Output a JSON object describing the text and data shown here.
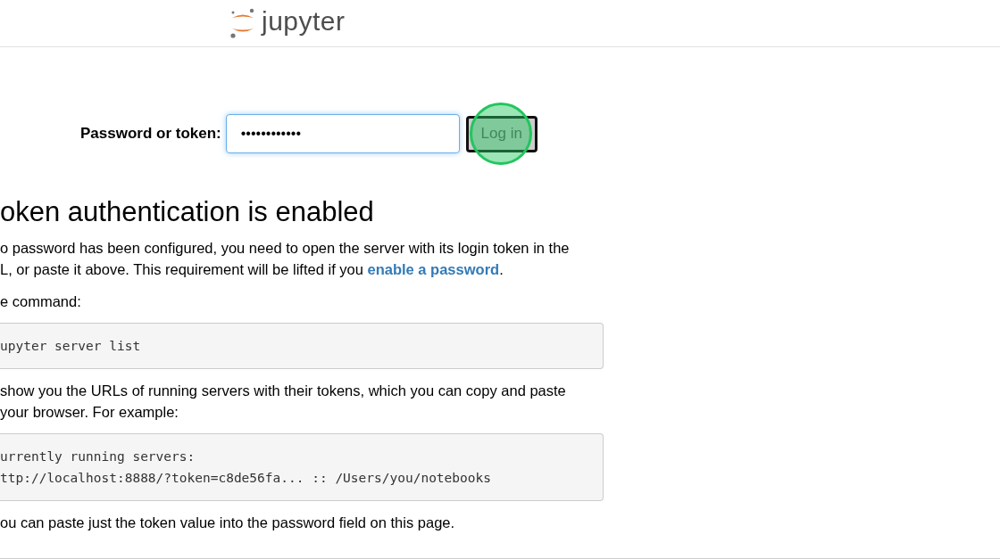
{
  "header": {
    "logo_text": "jupyter"
  },
  "login": {
    "label": "Password or token:",
    "value": "••••••••••••",
    "button": "Log in"
  },
  "heading": "oken authentication is enabled",
  "content": [
    {
      "kind": "text",
      "lines": [
        {
          "text": "o password has been configured, you need to open the server with its login token in the"
        },
        {
          "text": "L, or paste it above. This requirement will be lifted if you ",
          "link": "enable a password",
          "after": "."
        }
      ]
    },
    {
      "kind": "text",
      "lines": [
        {
          "text": "e command:"
        }
      ]
    },
    {
      "kind": "code",
      "lines": [
        {
          "text": "upyter server list"
        }
      ]
    },
    {
      "kind": "text",
      "lines": [
        {
          "text": "show you the URLs of running servers with their tokens, which you can copy and paste"
        },
        {
          "text": "your browser. For example:"
        }
      ]
    },
    {
      "kind": "code",
      "lines": [
        {
          "text": "urrently running servers:"
        },
        {
          "text": "ttp://localhost:8888/?token=c8de56fa... :: /Users/you/notebooks"
        }
      ]
    },
    {
      "kind": "text",
      "lines": [
        {
          "text": "ou can paste just the token value into the password field on this page."
        }
      ]
    }
  ]
}
